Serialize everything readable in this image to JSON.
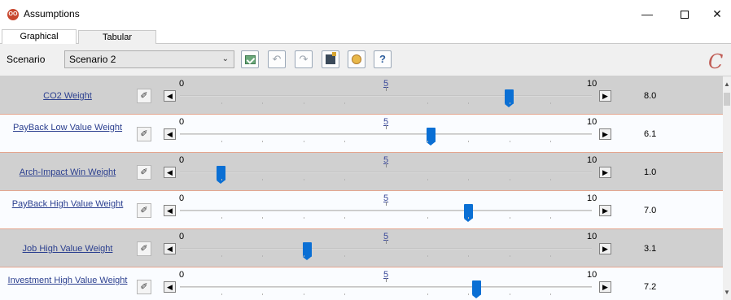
{
  "window": {
    "title": "Assumptions",
    "app_icon": "app-logo-icon",
    "controls": {
      "minimize": "—",
      "maximize": "",
      "close": "✕"
    }
  },
  "tabs": [
    {
      "label": "Graphical",
      "active": true
    },
    {
      "label": "Tabular",
      "active": false
    }
  ],
  "toolbar": {
    "scenario_label": "Scenario",
    "scenario_value": "Scenario 2",
    "buttons": [
      {
        "name": "apply-icon"
      },
      {
        "name": "undo-icon"
      },
      {
        "name": "redo-icon"
      },
      {
        "name": "grid-icon"
      },
      {
        "name": "idea-icon"
      },
      {
        "name": "help-icon"
      }
    ]
  },
  "slider_scale": {
    "min": "0",
    "mid": "5",
    "max": "10"
  },
  "rows": [
    {
      "label": "CO2 Weight",
      "value": "8.0",
      "level": 8.0
    },
    {
      "label": "PayBack  Low Value Weight",
      "value": "6.1",
      "level": 6.1
    },
    {
      "label": "Arch-Impact  Win Weight",
      "value": "1.0",
      "level": 1.0
    },
    {
      "label": "PayBack  High Value Weight",
      "value": "7.0",
      "level": 7.0
    },
    {
      "label": "Job  High Value Weight",
      "value": "3.1",
      "level": 3.1
    },
    {
      "label": "Investment  High Value Weight",
      "value": "7.2",
      "level": 7.2
    }
  ],
  "colors": {
    "odd_row": "#d0d0d0",
    "even_row": "#fafcff",
    "row_divider": "#e4a58f",
    "thumb": "#0a6fd4",
    "link": "#2b3f8f"
  }
}
